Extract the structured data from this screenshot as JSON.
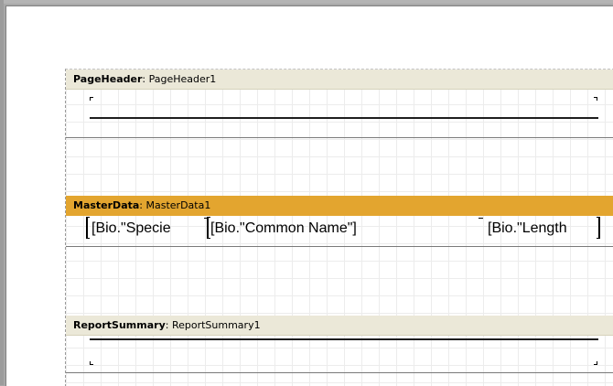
{
  "page_header": {
    "type": "PageHeader",
    "name": ": PageHeader1"
  },
  "master_data": {
    "type": "MasterData",
    "name": ": MasterData1",
    "fields": [
      {
        "text": "[Bio.\"Specie"
      },
      {
        "text": "[Bio.\"Common Name\"]"
      },
      {
        "text": "[Bio.\"Length"
      }
    ]
  },
  "report_summary": {
    "type": "ReportSummary",
    "name": ": ReportSummary1"
  },
  "colors": {
    "active_band": "#e3a52f",
    "neutral_band": "#ebe8d8",
    "grid": "#ececec"
  }
}
